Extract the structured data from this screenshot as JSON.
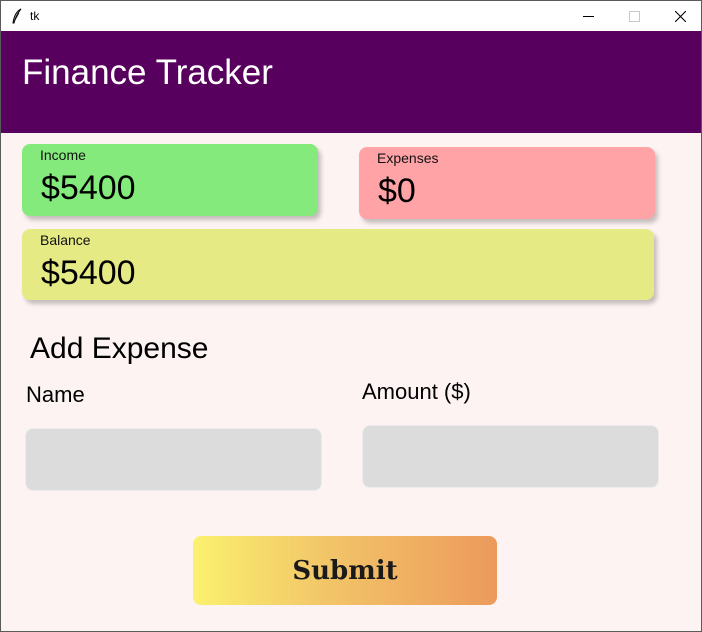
{
  "window": {
    "title": "tk",
    "controls": [
      "minimize",
      "maximize",
      "close"
    ]
  },
  "header": {
    "title": "Finance Tracker",
    "bg_color": "#58005e"
  },
  "summary": {
    "income": {
      "label": "Income",
      "value": "$5400",
      "color": "#84ea7c"
    },
    "expenses": {
      "label": "Expenses",
      "value": "$0",
      "color": "#ffa3a6"
    },
    "balance": {
      "label": "Balance",
      "value": "$5400",
      "color": "#e6ea84"
    }
  },
  "form": {
    "title": "Add Expense",
    "name_label": "Name",
    "name_value": "",
    "amount_label": "Amount ($)",
    "amount_value": "",
    "submit_label": "Submit"
  }
}
